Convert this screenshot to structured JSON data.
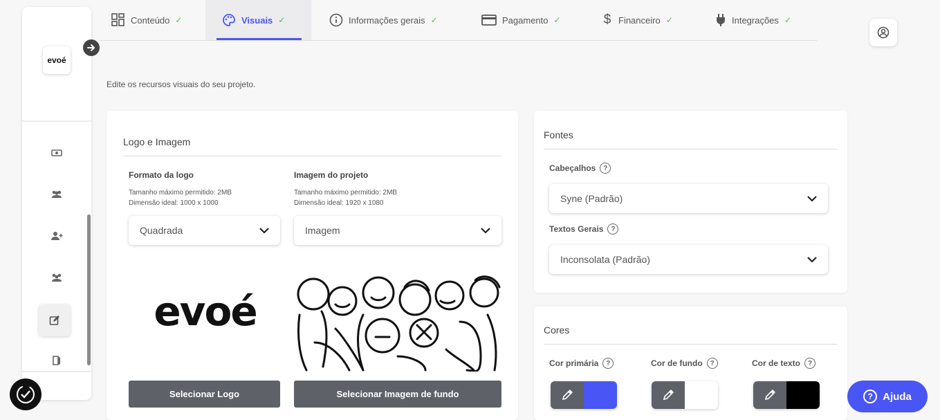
{
  "sidebar": {
    "logo_text": "evoé"
  },
  "tabs": [
    {
      "label": "Conteúdo",
      "check": "✓"
    },
    {
      "label": "Visuais",
      "check": "✓"
    },
    {
      "label": "Informações gerais",
      "check": "✓"
    },
    {
      "label": "Pagamento",
      "check": "✓"
    },
    {
      "label": "Financeiro",
      "check": "✓"
    },
    {
      "label": "Integrações",
      "check": "✓"
    }
  ],
  "subtitle": "Edite os recursos visuais do seu projeto.",
  "logo_card": {
    "title": "Logo e Imagem",
    "logo_format": {
      "label": "Formato da logo",
      "note_size": "Tamanho máximo permitido: 2MB",
      "note_dim": "Dimensão ideal: 1000 x 1000",
      "selected": "Quadrada",
      "preview_text": "evoé",
      "button": "Selecionar Logo"
    },
    "project_image": {
      "label": "Imagem do projeto",
      "note_size": "Tamanho máximo permitido: 2MB",
      "note_dim": "Dimensão ideal: 1920 x 1080",
      "selected": "Imagem",
      "button": "Selecionar Imagem de fundo"
    }
  },
  "fonts_card": {
    "title": "Fontes",
    "headers_label": "Cabeçalhos",
    "headers_value": "Syne (Padrão)",
    "texts_label": "Textos Gerais",
    "texts_value": "Inconsolata (Padrão)"
  },
  "colors_card": {
    "title": "Cores",
    "primary_label": "Cor primária",
    "primary_color": "#4a55f5",
    "background_label": "Cor de fundo",
    "background_color": "#ffffff",
    "text_label": "Cor de texto",
    "text_color": "#000000"
  },
  "help_button": "Ajuda",
  "colors": {
    "accent": "#4a55f5",
    "check": "#4fc04f"
  }
}
